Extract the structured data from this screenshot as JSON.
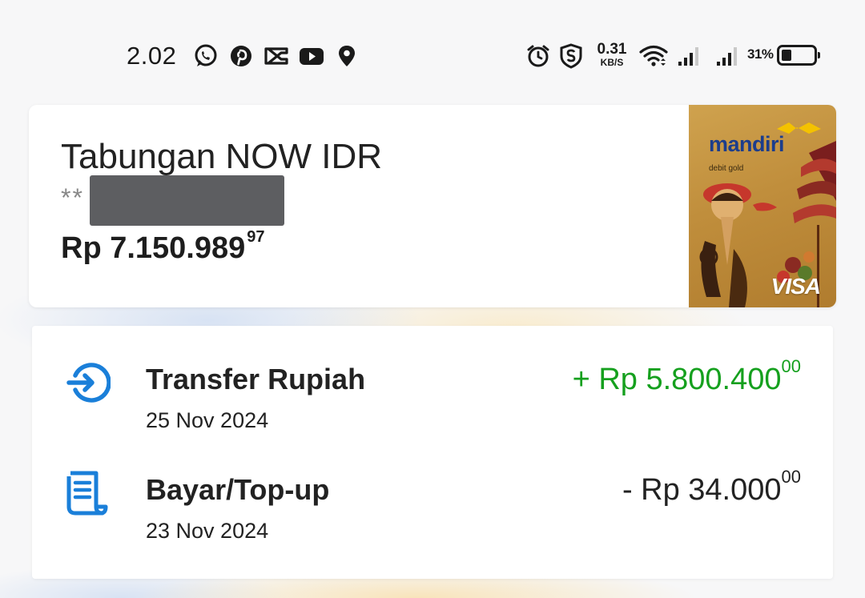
{
  "status_bar": {
    "time": "2.02",
    "net_speed_value": "0.31",
    "net_speed_unit": "KB/S",
    "battery_percent": "31%",
    "battery_level": 0.31,
    "notification_icons": [
      "whatsapp-icon",
      "pinterest-icon",
      "capcut-icon",
      "youtube-icon",
      "location-pin-icon"
    ],
    "system_icons": [
      "alarm-icon",
      "shield-s-icon",
      "wifi-icon",
      "signal-icon",
      "signal-icon",
      "battery-icon"
    ]
  },
  "account": {
    "name": "Tabungan NOW IDR",
    "masked_number_prefix": "**",
    "balance_main": "Rp 7.150.989",
    "balance_cents": "97"
  },
  "debit_card": {
    "brand": "mandiri",
    "tier": "debit gold",
    "network": "VISA"
  },
  "transactions": [
    {
      "title": "Transfer Rupiah",
      "date": "25 Nov 2024",
      "amount_main": "+ Rp 5.800.400",
      "amount_cents": "00",
      "direction": "in",
      "icon": "transfer-in-icon",
      "color": "#15a01e"
    },
    {
      "title": "Bayar/Top-up",
      "date": "23 Nov 2024",
      "amount_main": "- Rp 34.000",
      "amount_cents": "00",
      "direction": "out",
      "icon": "receipt-icon",
      "color": "#222222"
    }
  ],
  "colors": {
    "accent_blue": "#1a7fd9",
    "income_green": "#15a01e",
    "card_gold": "#c08e3c",
    "mandiri_blue": "#1c3d8c"
  }
}
